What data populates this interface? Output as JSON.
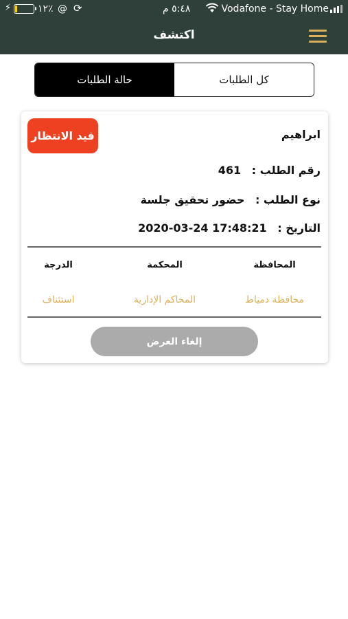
{
  "status_bar": {
    "carrier": "Vodafone - Stay Home",
    "time": "٥:٤٨ م",
    "battery_percent": "٪١٢",
    "at_symbol": "@",
    "battery_level": 0.12
  },
  "header": {
    "title": "اكتشف"
  },
  "tabs": {
    "all_requests": "كل الطلبات",
    "request_status": "حالة الطلبات",
    "active": "request_status"
  },
  "card": {
    "name": "ابراهيم",
    "status_badge": "قيد الانتظار",
    "request_number_label": "رقم الطلب :",
    "request_number": "461",
    "request_type_label": "نوع الطلب :",
    "request_type": "حضور تحقيق جلسة",
    "date_label": "التاريخ :",
    "date": "2020-03-24 17:48:21",
    "columns": [
      {
        "header": "المحافظة",
        "value": "محافظة دمياط"
      },
      {
        "header": "المحكمة",
        "value": "المحاكم الإدارية"
      },
      {
        "header": "الدرجة",
        "value": "استئناف"
      }
    ],
    "cancel_button": "إلغاء العرض"
  },
  "colors": {
    "header_bg": "#2f3f39",
    "accent_gold": "#d9b15a",
    "badge_red": "#ee4121",
    "button_gray": "#ababab"
  }
}
